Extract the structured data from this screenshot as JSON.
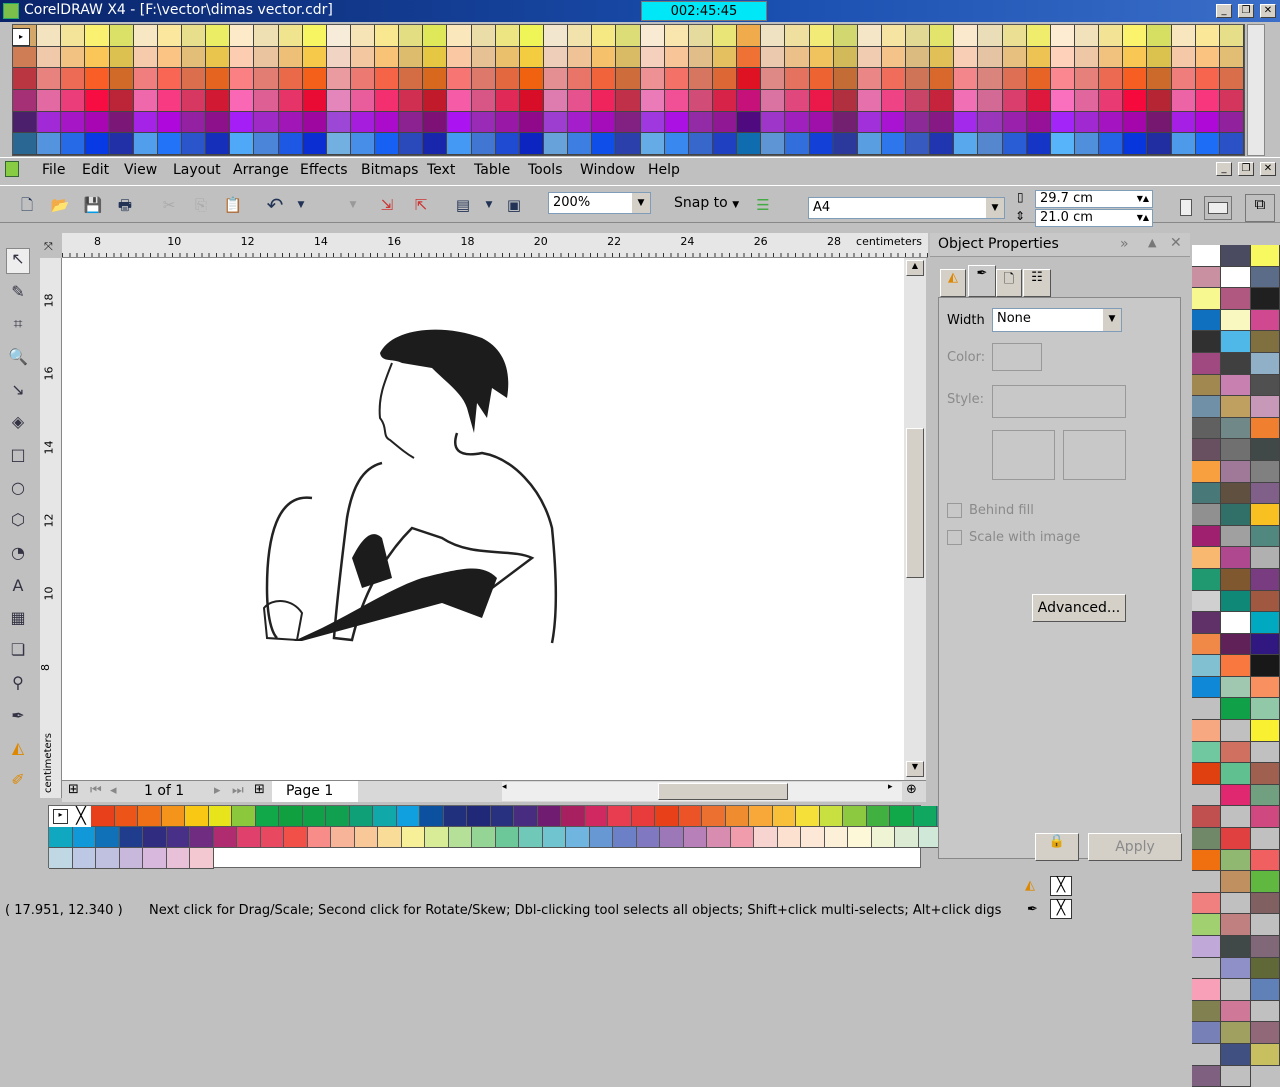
{
  "window": {
    "title": "CorelDRAW X4 - [F:\\vector\\dimas vector.cdr]",
    "timer": "002:45:45"
  },
  "menu": [
    "File",
    "Edit",
    "View",
    "Layout",
    "Arrange",
    "Effects",
    "Bitmaps",
    "Text",
    "Table",
    "Tools",
    "Window",
    "Help"
  ],
  "toolbar": {
    "zoom": "200%",
    "snap_to": "Snap to",
    "page_size": "A4",
    "width": "29.7 cm",
    "height": "21.0 cm"
  },
  "ruler": {
    "h_ticks": [
      "8",
      "10",
      "12",
      "14",
      "16",
      "18",
      "20",
      "22",
      "24",
      "26",
      "28"
    ],
    "h_unit": "centimeters",
    "v_ticks": [
      "18",
      "16",
      "14",
      "12",
      "10",
      "8"
    ],
    "v_unit": "centimeters"
  },
  "pagenav": {
    "count": "1 of 1",
    "tab": "Page 1"
  },
  "panel": {
    "title": "Object Properties",
    "width_label": "Width",
    "width_value": "None",
    "color_label": "Color:",
    "style_label": "Style:",
    "behind_fill": "Behind fill",
    "scale_with_image": "Scale with image",
    "advanced": "Advanced...",
    "apply": "Apply"
  },
  "status": {
    "coords": "( 17.951, 12.340 )",
    "hint": "Next click for Drag/Scale; Second click for Rotate/Skew; Dbl-clicking tool selects all objects; Shift+click multi-selects; Alt+click digs"
  },
  "colors": {
    "bottom_palette": [
      [
        "#e8401a",
        "#ec5418",
        "#f07018",
        "#f4941a",
        "#f8c814",
        "#e8e41c",
        "#8cc83c",
        "#10a848",
        "#10a040",
        "#10a048",
        "#10a050",
        "#10a078",
        "#10a8a8",
        "#10a0e0",
        "#0c50a0",
        "#20307c",
        "#202878",
        "#283080",
        "#482c80",
        "#701c70",
        "#a82060",
        "#d02860",
        "#e83c50",
        "#e83c3c",
        "#e84018",
        "#ec5428",
        "#ec7030",
        "#f08c30",
        "#f8a838",
        "#f8c038",
        "#f4e038",
        "#c8e040",
        "#8cc840",
        "#40b040",
        "#10a848",
        "#10a860",
        "#10a8a0"
      ],
      [
        "#10a8c0",
        "#1098d8",
        "#1070b8",
        "#203c8c",
        "#302c80",
        "#483088",
        "#702c80",
        "#b02c70",
        "#e0406c",
        "#e84860",
        "#f05048",
        "#f88c88",
        "#f8b498",
        "#f8c898",
        "#f8dc98",
        "#f8f098",
        "#d8ec98",
        "#b4e098",
        "#94d494",
        "#6cc898",
        "#70c8b8",
        "#70c4d0",
        "#70b4e0",
        "#6898d4",
        "#6c80c8",
        "#8078c0",
        "#9c78b8",
        "#b880b8",
        "#d88cb0",
        "#f09cac",
        "#f8d4d0",
        "#fce0d0",
        "#fde8d8",
        "#fdf0d8",
        "#fcf8d8",
        "#eef4d4",
        "#dcecd4",
        "#d0e8d8",
        "#c8e4e0"
      ],
      [
        "#c0d8e4",
        "#bcc8e4",
        "#c0c0e0",
        "#c8b8dc",
        "#d8b8dc",
        "#e8c0d8",
        "#f4c8d0"
      ]
    ]
  }
}
